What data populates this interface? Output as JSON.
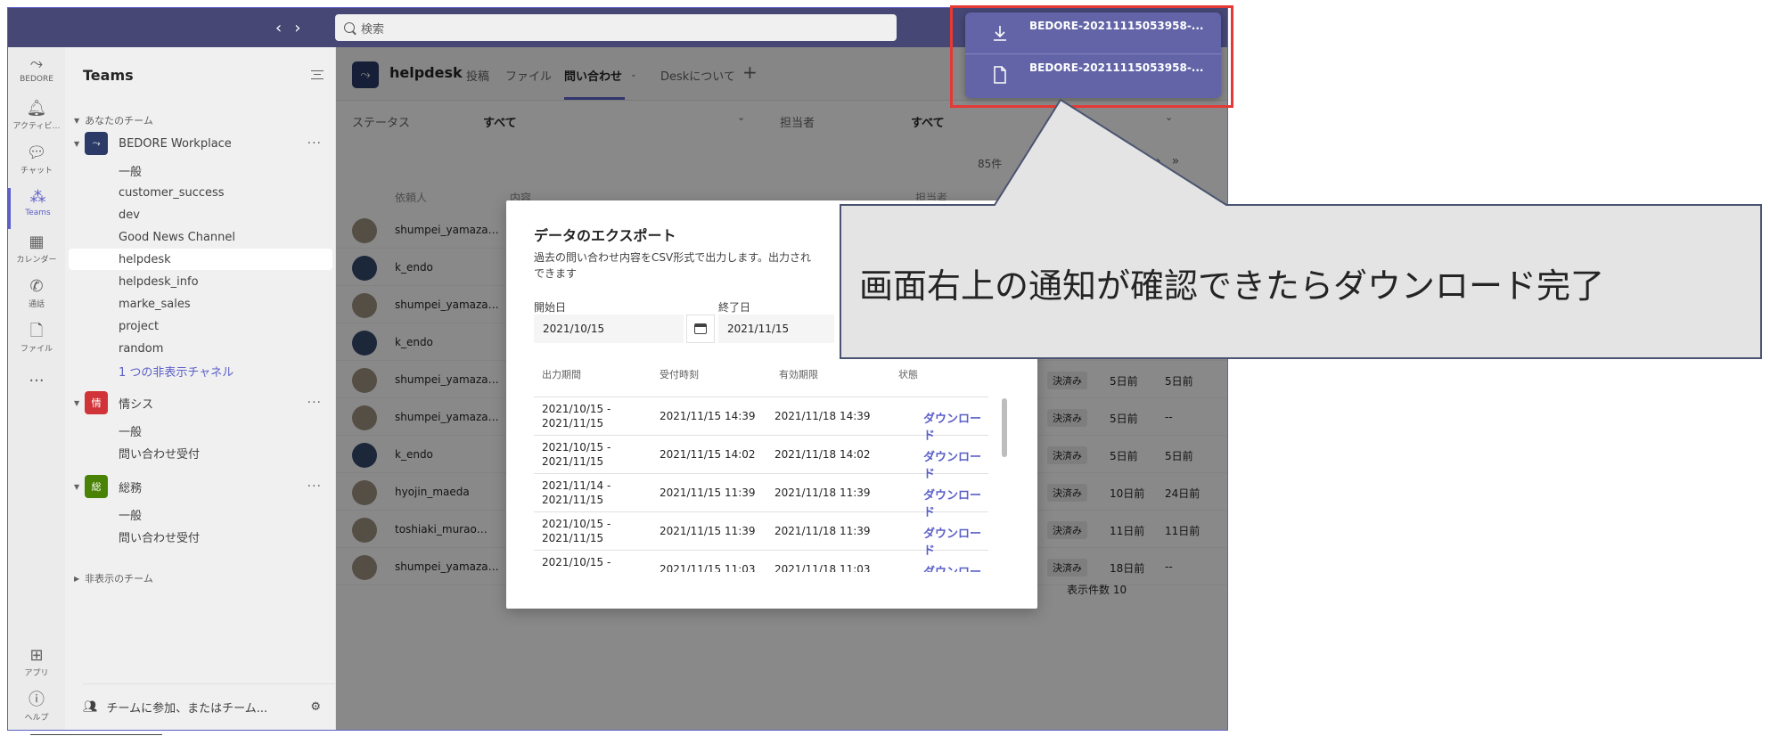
{
  "search": {
    "placeholder": "検索"
  },
  "rail": [
    {
      "icon": "bedore-icon",
      "label": "BEDORE"
    },
    {
      "icon": "bell-icon",
      "label": "アクティビ…"
    },
    {
      "icon": "chat-icon",
      "label": "チャット"
    },
    {
      "icon": "teams-icon",
      "label": "Teams"
    },
    {
      "icon": "calendar-icon",
      "label": "カレンダー"
    },
    {
      "icon": "phone-icon",
      "label": "通話"
    },
    {
      "icon": "file-icon",
      "label": "ファイル"
    },
    {
      "icon": "more-icon",
      "label": ""
    },
    {
      "icon": "apps-icon",
      "label": "アプリ"
    },
    {
      "icon": "help-icon",
      "label": "ヘルプ"
    }
  ],
  "sidebar": {
    "title": "Teams",
    "section_your_teams": "あなたのチーム",
    "team1": {
      "name": "BEDORE Workplace",
      "channels": [
        "一般",
        "customer_success",
        "dev",
        "Good News Channel",
        "helpdesk",
        "helpdesk_info",
        "marke_sales",
        "project",
        "random"
      ],
      "hidden": "1 つの非表示チャネル"
    },
    "team2": {
      "name": "情シス",
      "avatar": "情",
      "channels": [
        "一般",
        "問い合わせ受付"
      ]
    },
    "team3": {
      "name": "総務",
      "avatar": "総",
      "channels": [
        "一般",
        "問い合わせ受付"
      ]
    },
    "hidden_teams": "非表示のチーム",
    "join": "チームに参加、またはチーム..."
  },
  "channel": {
    "name": "helpdesk",
    "tabs": [
      "投稿",
      "ファイル",
      "問い合わせ",
      "Deskについて"
    ]
  },
  "filters": {
    "status_label": "ステータス",
    "status_value": "すべて",
    "assignee_label": "担当者",
    "assignee_value": "すべて"
  },
  "list": {
    "count": "85件",
    "headers": {
      "requester": "依頼人",
      "content": "内容",
      "assignee": "担当者"
    },
    "rows": [
      {
        "name": "shumpei_yamaza…",
        "status": "",
        "t1": "",
        "t2": ""
      },
      {
        "name": "k_endo",
        "status": "",
        "t1": "",
        "t2": ""
      },
      {
        "name": "shumpei_yamaza…",
        "status": "",
        "t1": "",
        "t2": ""
      },
      {
        "name": "k_endo",
        "status": "",
        "t1": "",
        "t2": ""
      },
      {
        "name": "shumpei_yamaza…",
        "status": "決済み",
        "t1": "5日前",
        "t2": "5日前"
      },
      {
        "name": "shumpei_yamaza…",
        "status": "決済み",
        "t1": "5日前",
        "t2": "--"
      },
      {
        "name": "k_endo",
        "status": "決済み",
        "t1": "5日前",
        "t2": "5日前"
      },
      {
        "name": "hyojin_maeda",
        "status": "決済み",
        "t1": "10日前",
        "t2": "24日前"
      },
      {
        "name": "toshiaki_murao…",
        "status": "決済み",
        "t1": "11日前",
        "t2": "11日前"
      },
      {
        "name": "shumpei_yamaza…",
        "status": "決済み",
        "t1": "18日前",
        "t2": "--"
      }
    ],
    "page_size": "表示件数 10"
  },
  "modal": {
    "title": "データのエクスポート",
    "desc": "過去の問い合わせ内容をCSV形式で出力します。出力され\nできます",
    "start_label": "開始日",
    "start_value": "2021/10/15",
    "end_label": "終了日",
    "end_value": "2021/11/15",
    "headers": {
      "period": "出力期間",
      "accepted": "受付時刻",
      "expires": "有効期限",
      "state": "状態"
    },
    "rows": [
      {
        "period": "2021/10/15 -\n2021/11/15",
        "accepted": "2021/11/15 14:39",
        "expires": "2021/11/18 14:39",
        "state": "ダウンロード"
      },
      {
        "period": "2021/10/15 -\n2021/11/15",
        "accepted": "2021/11/15 14:02",
        "expires": "2021/11/18 14:02",
        "state": "ダウンロード"
      },
      {
        "period": "2021/11/14 -\n2021/11/15",
        "accepted": "2021/11/15 11:39",
        "expires": "2021/11/18 11:39",
        "state": "ダウンロード"
      },
      {
        "period": "2021/10/15 -\n2021/11/15",
        "accepted": "2021/11/15 11:39",
        "expires": "2021/11/18 11:39",
        "state": "ダウンロード"
      },
      {
        "period": "2021/10/15 -",
        "accepted": "2021/11/15 11:03",
        "expires": "2021/11/18 11:03",
        "state": "ダウンロード"
      }
    ]
  },
  "notifications": [
    {
      "icon": "download-icon",
      "text": "BEDORE-20211115053958-..."
    },
    {
      "icon": "document-icon",
      "text": "BEDORE-20211115053958-..."
    }
  ],
  "callout": {
    "text": "画面右上の通知が確認できたらダウンロード完了"
  },
  "colors": {
    "accent": "#5b5fc7",
    "topbar": "#464775",
    "highlight": "#e53935"
  }
}
